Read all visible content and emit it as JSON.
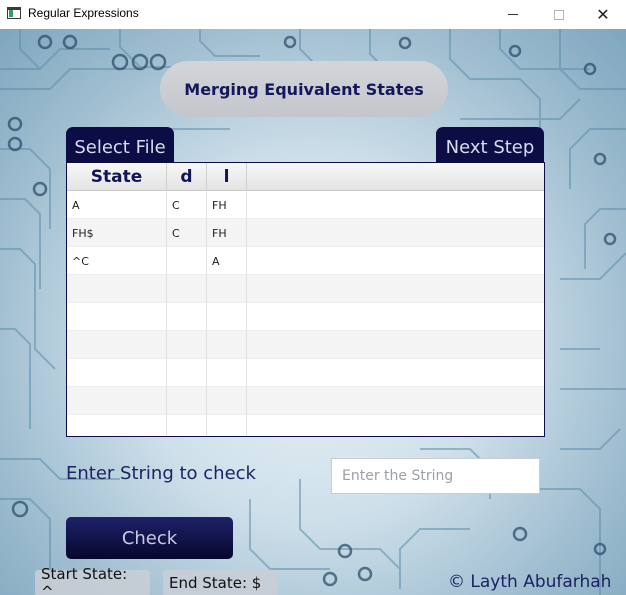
{
  "window": {
    "title": "Regular Expressions",
    "minimize_label": "—",
    "close_label": "✕"
  },
  "header": {
    "title": "Merging Equivalent States"
  },
  "buttons": {
    "select_file": "Select File",
    "next_step": "Next Step",
    "check": "Check"
  },
  "table": {
    "columns": [
      "State",
      "d",
      "l",
      ""
    ],
    "rows": [
      [
        "A",
        "C",
        "FH",
        ""
      ],
      [
        "FH$",
        "C",
        "FH",
        ""
      ],
      [
        "^C",
        "",
        "A",
        ""
      ],
      [
        "",
        "",
        "",
        ""
      ],
      [
        "",
        "",
        "",
        ""
      ],
      [
        "",
        "",
        "",
        ""
      ],
      [
        "",
        "",
        "",
        ""
      ],
      [
        "",
        "",
        "",
        ""
      ],
      [
        "",
        "",
        "",
        ""
      ]
    ]
  },
  "check_form": {
    "prompt": "Enter String to check",
    "placeholder": "Enter the String",
    "value": ""
  },
  "footer": {
    "start_state": "Start State: ^",
    "end_state": "End State: $",
    "copyright": "© Layth Abufarhah"
  },
  "colors": {
    "accent_dark": "#0c0d45",
    "text_navy": "#1c2363",
    "header_pill": "#c8cacf"
  },
  "icons": {
    "app": "window-app-icon",
    "minimize": "minimize-icon",
    "maximize": "maximize-icon",
    "close": "close-icon",
    "background": "circuit-board-background"
  }
}
